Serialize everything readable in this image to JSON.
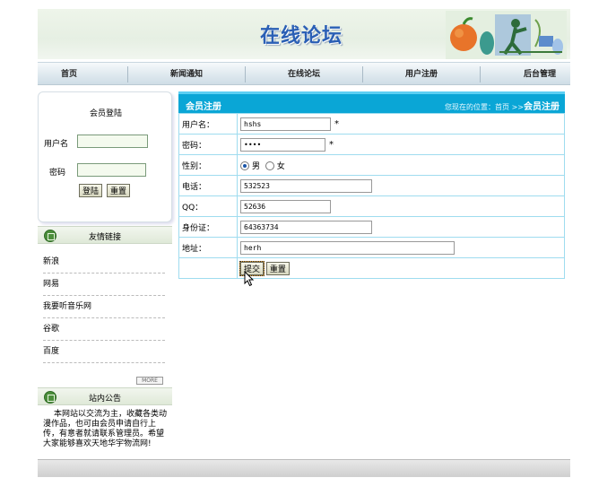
{
  "header": {
    "site_title": "在线论坛"
  },
  "nav": [
    "首页",
    "新闻通知",
    "在线论坛",
    "用户注册",
    "后台管理"
  ],
  "login": {
    "title": "会员登陆",
    "username_label": "用户名",
    "password_label": "密码",
    "username_value": "",
    "password_value": "",
    "login_button": "登陆",
    "reset_button": "重置"
  },
  "friend_links": {
    "title": "友情链接",
    "items": [
      "新浪",
      "网易",
      "我要听音乐网",
      "谷歌",
      "百度"
    ],
    "more_label": "MORE"
  },
  "notice": {
    "title": "站内公告",
    "text": "本网站以交流为主，收藏各类动漫作品，也可由会员申请自行上传，有意者就请联系管理员。希望大家能够喜欢天地华宇物流网!"
  },
  "register": {
    "panel_title": "会员注册",
    "breadcrumb_prefix": "您现在的位置：首页 >>",
    "breadcrumb_current": "会员注册",
    "fields": {
      "username": {
        "label": "用户名：",
        "value": "hshs",
        "required_mark": "*"
      },
      "password": {
        "label": "密码：",
        "value": "••••",
        "required_mark": "*"
      },
      "gender": {
        "label": "性别：",
        "option_male": "男",
        "option_female": "女",
        "selected": "男"
      },
      "phone": {
        "label": "电话：",
        "value": "532523"
      },
      "qq": {
        "label": "QQ：",
        "value": "52636"
      },
      "id_card": {
        "label": "身份证：",
        "value": "64363734"
      },
      "address": {
        "label": "地址：",
        "value": "herh"
      }
    },
    "submit_button": "提交",
    "reset_button": "重置"
  },
  "colors": {
    "panel_header": "#0aa6d6",
    "title_blue": "#2a5fb5",
    "table_border": "#9fdcef"
  }
}
